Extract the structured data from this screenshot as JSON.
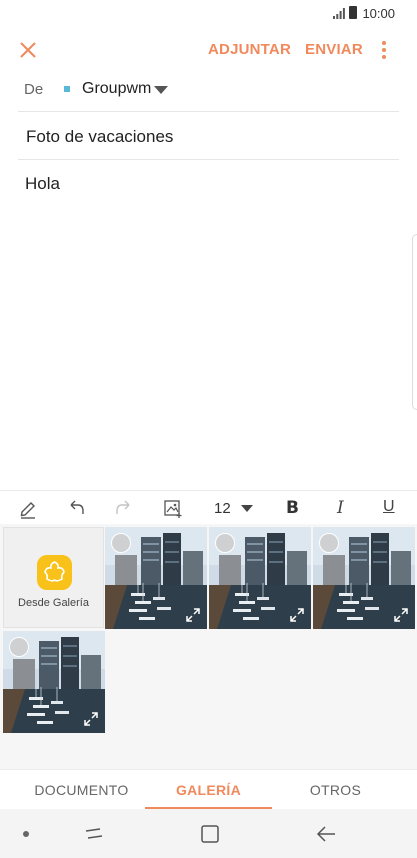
{
  "status_bar": {
    "time": "10:00"
  },
  "toolbar": {
    "attach_label": "ADJUNTAR",
    "send_label": "ENVIAR"
  },
  "from": {
    "label": "De",
    "account": "Groupwm"
  },
  "subject": "Foto de vacaciones",
  "body": "Hola",
  "format_bar": {
    "font_size": "12",
    "bold": "B",
    "italic": "I",
    "underline": "U"
  },
  "gallery": {
    "from_gallery_label": "Desde Galería",
    "photo_count": 4
  },
  "tabs": [
    {
      "label": "DOCUMENTO",
      "active": false
    },
    {
      "label": "GALERÍA",
      "active": true
    },
    {
      "label": "OTROS",
      "active": false
    }
  ],
  "colors": {
    "accent": "#f08a5d",
    "gallery_icon": "#f9c21b",
    "account_dot": "#5bb7d6"
  }
}
